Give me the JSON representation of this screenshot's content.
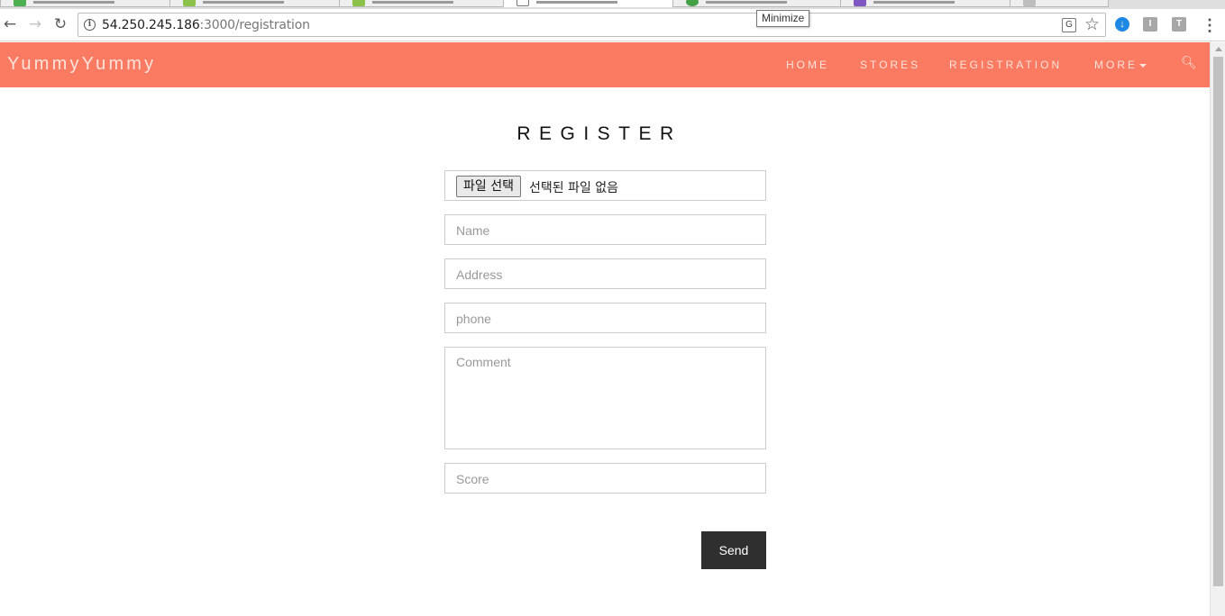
{
  "browser": {
    "url_host": "54.250.245.186",
    "url_path": ":3000/registration",
    "tooltip": "Minimize",
    "ext_i": "I",
    "ext_t": "T"
  },
  "site": {
    "brand": "YummyYummy",
    "nav": [
      "HOME",
      "STORES",
      "REGISTRATION",
      "MORE"
    ],
    "accent_color": "#fa7b62"
  },
  "form": {
    "title": "REGISTER",
    "file_button": "파일 선택",
    "file_status": "선택된 파일 없음",
    "name_placeholder": "Name",
    "address_placeholder": "Address",
    "phone_placeholder": "phone",
    "comment_placeholder": "Comment",
    "score_placeholder": "Score",
    "send_label": "Send"
  }
}
